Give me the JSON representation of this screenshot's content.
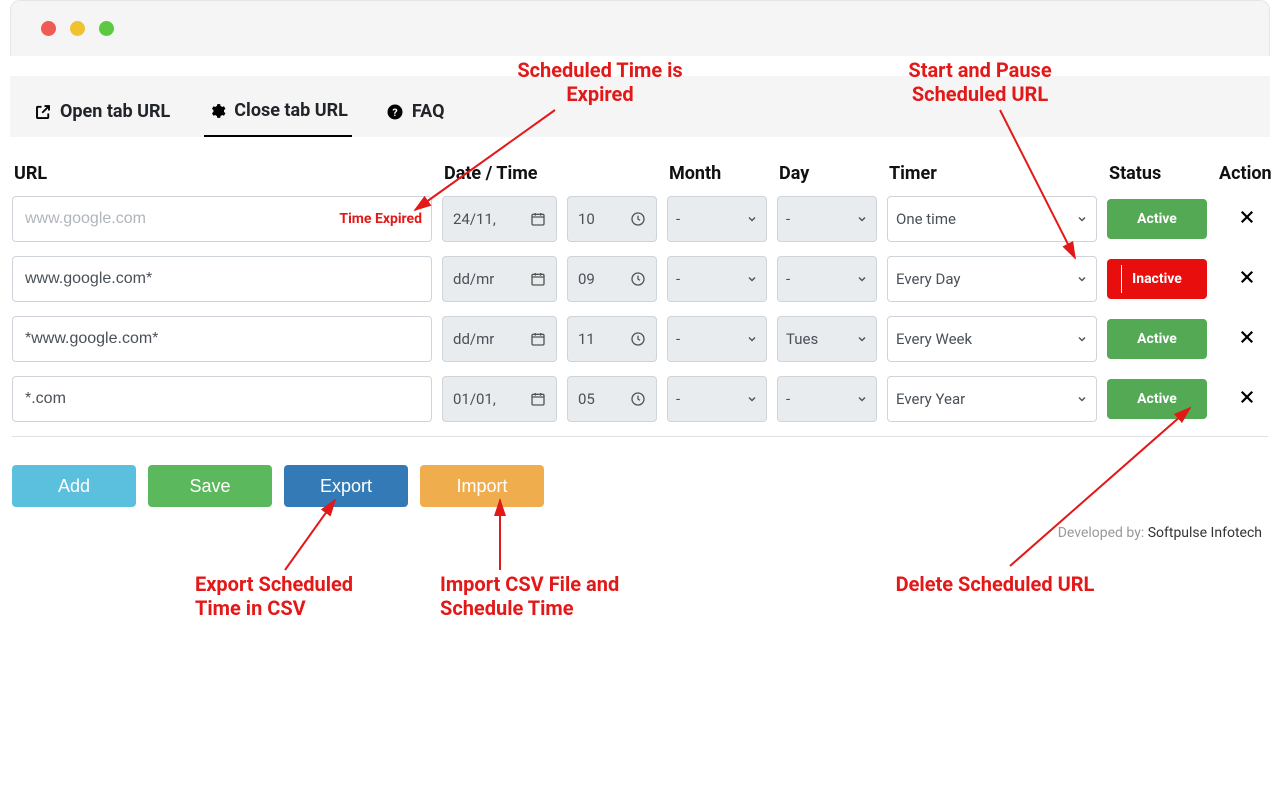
{
  "tabs": {
    "open": "Open tab URL",
    "close": "Close tab URL",
    "faq": "FAQ"
  },
  "headers": {
    "url": "URL",
    "datetime": "Date / Time",
    "month": "Month",
    "day": "Day",
    "timer": "Timer",
    "status": "Status",
    "action": "Action"
  },
  "expired_label": "Time Expired",
  "rows": [
    {
      "url_placeholder": "www.google.com",
      "url": "",
      "expired": true,
      "date": "24/11,",
      "time": "10",
      "month": "-",
      "day": "-",
      "timer": "One time",
      "status": "Active"
    },
    {
      "url_placeholder": "",
      "url": "www.google.com*",
      "expired": false,
      "date": "dd/mr",
      "time": "09",
      "month": "-",
      "day": "-",
      "timer": "Every Day",
      "status": "Inactive"
    },
    {
      "url_placeholder": "",
      "url": "*www.google.com*",
      "expired": false,
      "date": "dd/mr",
      "time": "11",
      "month": "-",
      "day": "Tues",
      "timer": "Every Week",
      "status": "Active"
    },
    {
      "url_placeholder": "",
      "url": "*.com",
      "expired": false,
      "date": "01/01,",
      "time": "05",
      "month": "-",
      "day": "-",
      "timer": "Every Year",
      "status": "Active"
    }
  ],
  "buttons": {
    "add": "Add",
    "save": "Save",
    "export": "Export",
    "import": "Import"
  },
  "footer": {
    "text": "Developed by: ",
    "link": "Softpulse Infotech"
  },
  "annotations": {
    "expired": "Scheduled Time is\nExpired",
    "startpause": "Start and Pause\nScheduled URL",
    "export": "Export Scheduled\nTime in CSV",
    "import": "Import CSV File and\nSchedule Time",
    "delete": "Delete Scheduled URL"
  }
}
